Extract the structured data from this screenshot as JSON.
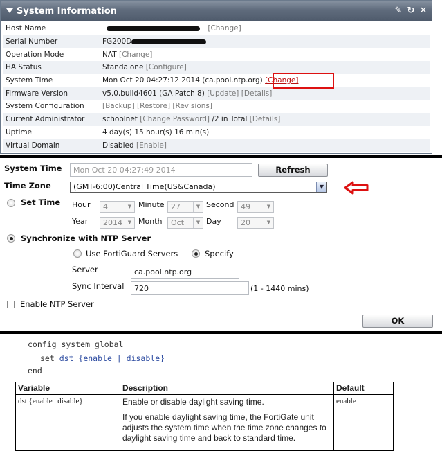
{
  "sysinfo": {
    "title": "System Information",
    "icons": {
      "edit": "✎",
      "refresh": "↻",
      "close": "✕"
    },
    "rows": [
      {
        "key": "Host Name",
        "value": "",
        "links": [
          "[Change]"
        ]
      },
      {
        "key": "Serial Number",
        "value": "FG200D",
        "links": []
      },
      {
        "key": "Operation Mode",
        "value": "NAT",
        "links": [
          "[Change]"
        ]
      },
      {
        "key": "HA Status",
        "value": "Standalone",
        "links": [
          "[Configure]"
        ]
      },
      {
        "key": "System Time",
        "value": "Mon Oct 20 04:27:12 2014 (ca.pool.ntp.org)",
        "links": [
          "[Change]"
        ]
      },
      {
        "key": "Firmware Version",
        "value": "v5.0,build4601 (GA Patch 8)",
        "links": [
          "[Update]",
          "[Details]"
        ]
      },
      {
        "key": "System Configuration",
        "value": "",
        "links": [
          "[Backup]",
          "[Restore]",
          "[Revisions]"
        ]
      },
      {
        "key": "Current Administrator",
        "value": "schoolnet",
        "links": [
          "[Change Password]"
        ],
        "suffix": "/2 in Total",
        "links2": [
          "[Details]"
        ]
      },
      {
        "key": "Uptime",
        "value": "4 day(s) 15 hour(s) 16 min(s)",
        "links": []
      },
      {
        "key": "Virtual Domain",
        "value": "Disabled",
        "links": [
          "[Enable]"
        ]
      }
    ]
  },
  "timeform": {
    "system_time_label": "System Time",
    "system_time_value": "Mon Oct 20 04:27:49 2014",
    "refresh_label": "Refresh",
    "time_zone_label": "Time Zone",
    "time_zone_value": "(GMT-6:00)Central Time(US&Canada)",
    "set_time_label": "Set Time",
    "hour_label": "Hour",
    "hour_value": "4",
    "minute_label": "Minute",
    "minute_value": "27",
    "second_label": "Second",
    "second_value": "49",
    "year_label": "Year",
    "year_value": "2014",
    "month_label": "Month",
    "month_value": "Oct",
    "day_label": "Day",
    "day_value": "20",
    "ntp_label": "Synchronize with NTP Server",
    "fortiguard_label": "Use FortiGuard Servers",
    "specify_label": "Specify",
    "server_label": "Server",
    "server_value": "ca.pool.ntp.org",
    "sync_label": "Sync Interval",
    "sync_value": "720",
    "sync_range": "(1 - 1440 mins)",
    "enable_ntp_label": "Enable NTP Server",
    "ok_label": "OK"
  },
  "doc": {
    "code_line1": "config system global",
    "code_set": "set",
    "code_args": "dst {enable | disable}",
    "code_end": "end",
    "headers": [
      "Variable",
      "Description",
      "Default"
    ],
    "variable": "dst {enable | disable}",
    "desc1": "Enable or disable daylight saving time.",
    "desc2": "If you enable daylight saving time, the FortiGate unit adjusts the system time when the time zone changes to daylight saving time and back to standard time.",
    "default": "enable"
  },
  "colors": {
    "titlebar": "#5f6b7c",
    "highlight": "#dd1111",
    "link": "#7a7a7a"
  }
}
